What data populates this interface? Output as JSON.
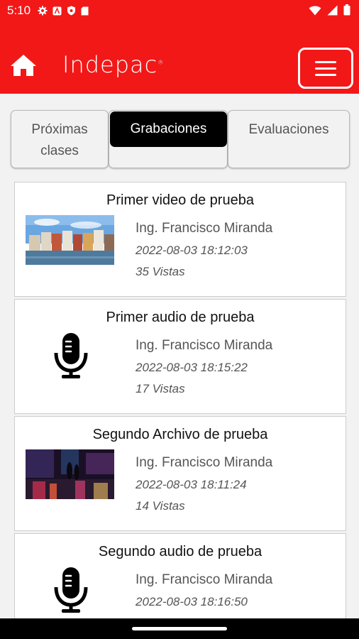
{
  "status": {
    "time": "5:10"
  },
  "header": {
    "logo_text": "Indepac",
    "logo_mark": "®"
  },
  "tabs": [
    {
      "label": "Próximas clases"
    },
    {
      "label": "Grabaciones"
    },
    {
      "label": "Evaluaciones"
    }
  ],
  "recordings": [
    {
      "title": "Primer video de prueba",
      "author": "Ing. Francisco Miranda",
      "date": "2022-08-03 18:12:03",
      "views": "35 Vistas",
      "media": "video"
    },
    {
      "title": "Primer audio de prueba",
      "author": "Ing. Francisco Miranda",
      "date": "2022-08-03 18:15:22",
      "views": "17 Vistas",
      "media": "audio"
    },
    {
      "title": "Segundo Archivo de prueba",
      "author": "Ing. Francisco Miranda",
      "date": "2022-08-03 18:11:24",
      "views": "14 Vistas",
      "media": "video"
    },
    {
      "title": "Segundo audio de prueba",
      "author": "Ing. Francisco Miranda",
      "date": "2022-08-03 18:16:50",
      "views": "",
      "media": "audio"
    }
  ],
  "colors": {
    "brand_red": "#f21818",
    "active_tab": "#000000"
  }
}
